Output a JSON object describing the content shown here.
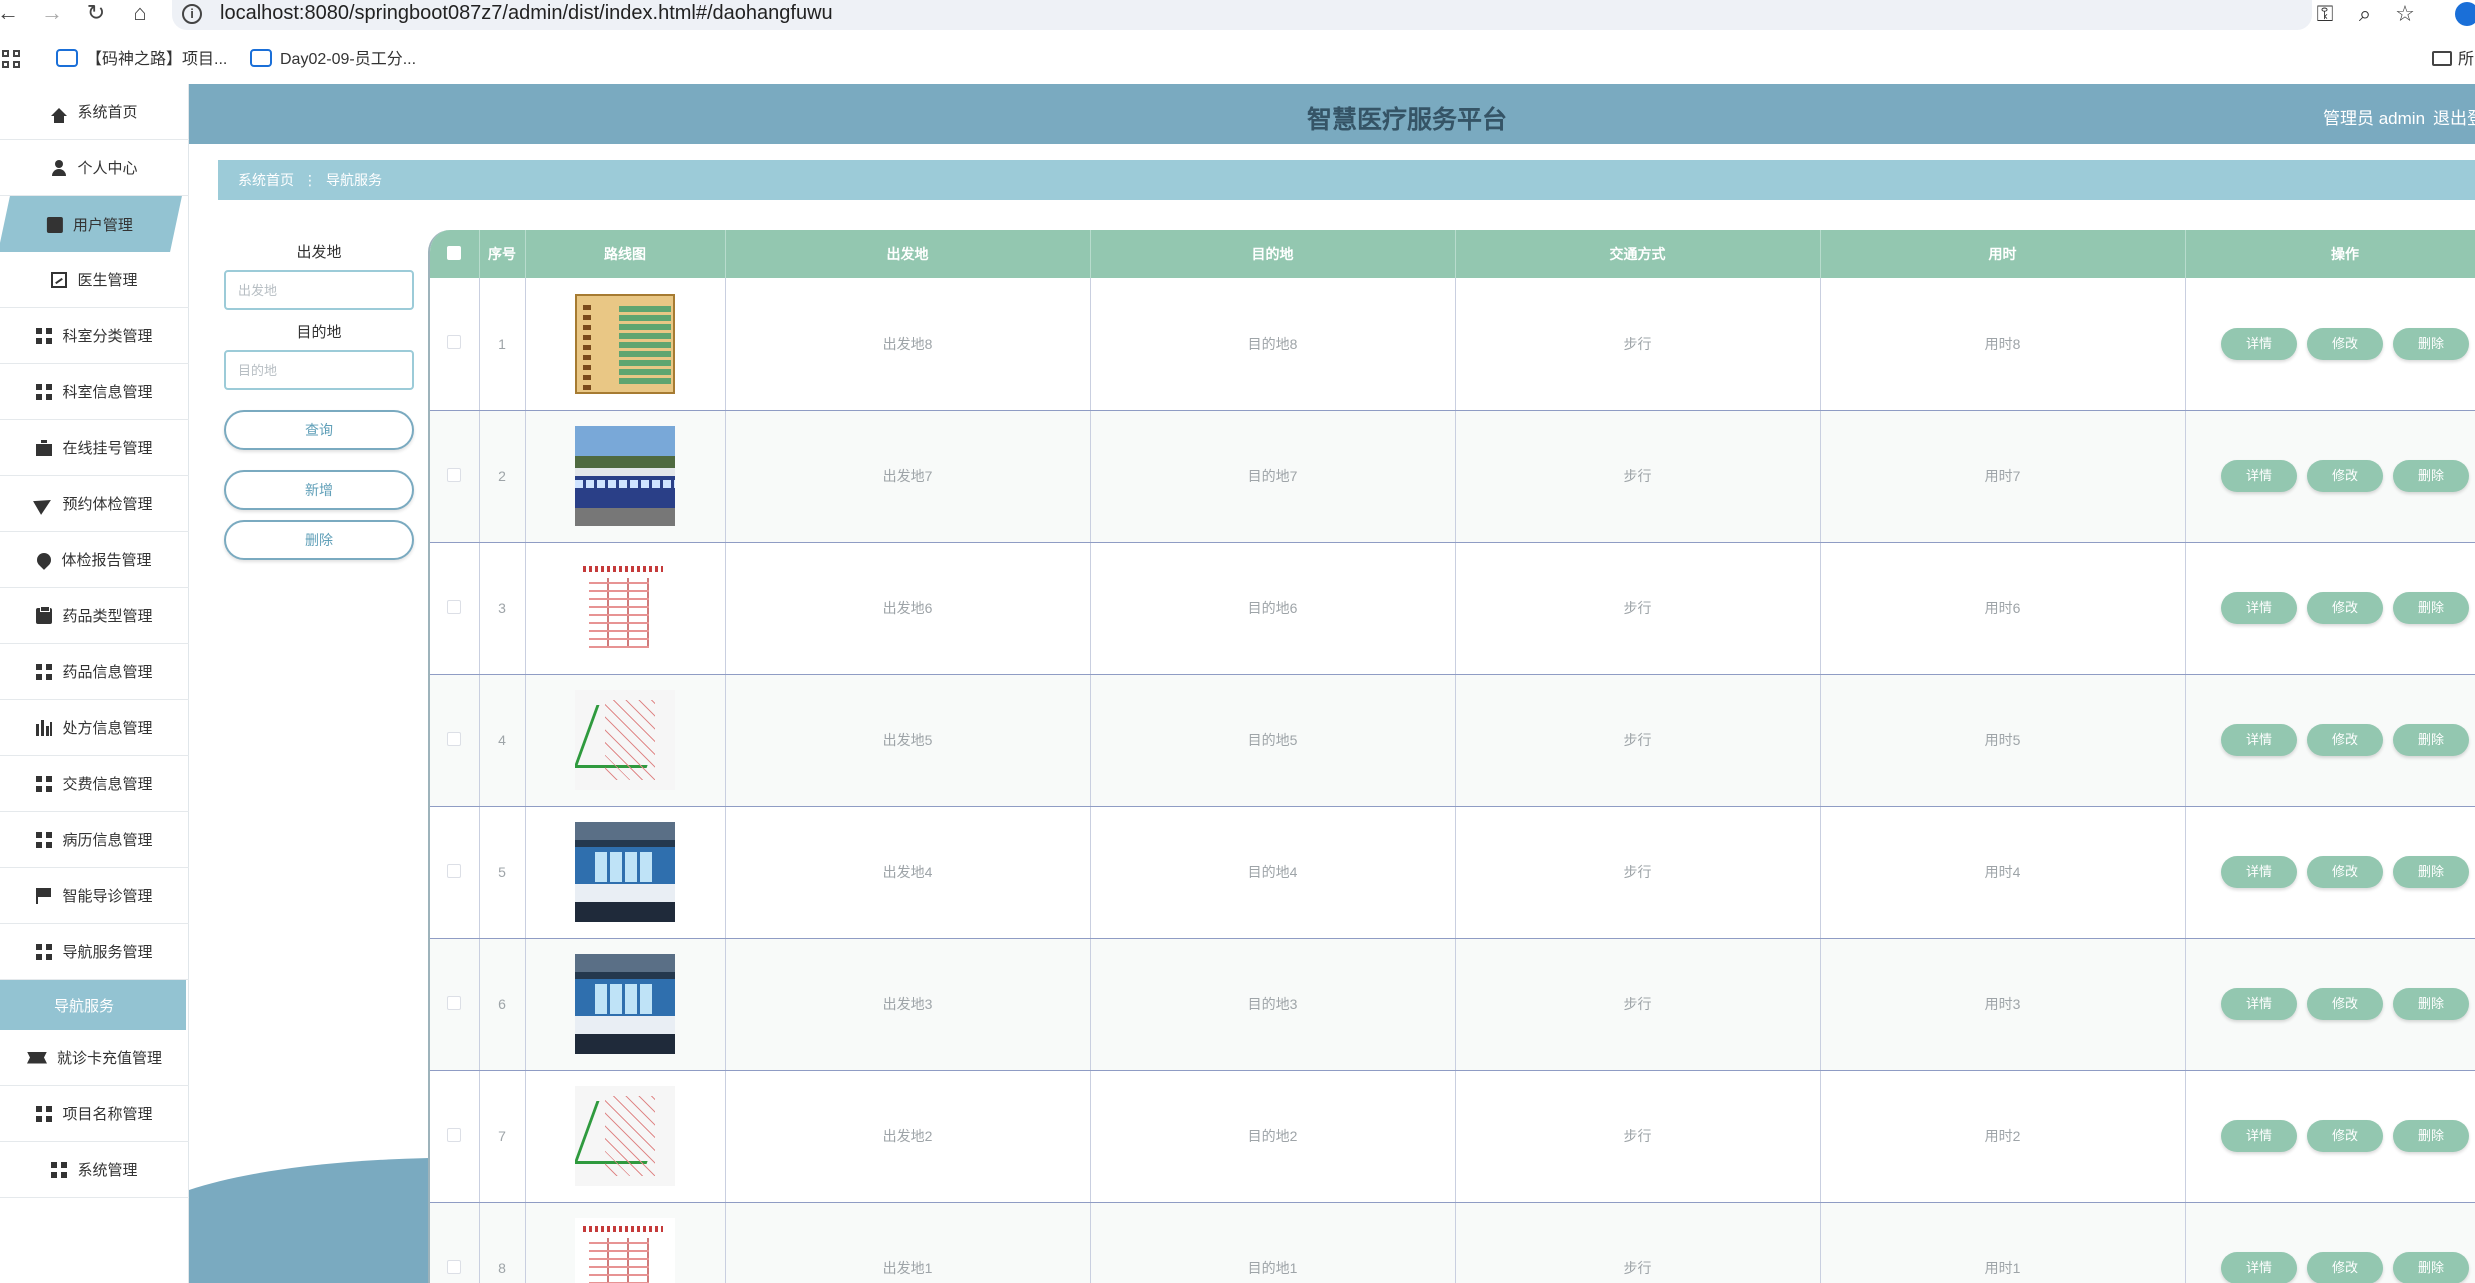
{
  "browser": {
    "url": "localhost:8080/springboot087z7/admin/dist/index.html#/daohangfuwu",
    "bookmarks": [
      "【码神之路】项目...",
      "Day02-09-员工分..."
    ],
    "folder_bookmark": "所"
  },
  "header": {
    "title": "智慧医疗服务平台",
    "admin": "管理员 admin",
    "logout": "退出登"
  },
  "sidebar": {
    "items": [
      {
        "label": "系统首页",
        "icon": "home-icon"
      },
      {
        "label": "个人中心",
        "icon": "user-icon"
      },
      {
        "label": "用户管理",
        "icon": "block-icon"
      },
      {
        "label": "医生管理",
        "icon": "chart-icon"
      },
      {
        "label": "科室分类管理",
        "icon": "grid-icon"
      },
      {
        "label": "科室信息管理",
        "icon": "grid-icon"
      },
      {
        "label": "在线挂号管理",
        "icon": "briefcase-icon"
      },
      {
        "label": "预约体检管理",
        "icon": "plane-icon"
      },
      {
        "label": "体检报告管理",
        "icon": "pin-icon"
      },
      {
        "label": "药品类型管理",
        "icon": "clipboard-icon"
      },
      {
        "label": "药品信息管理",
        "icon": "grid-icon"
      },
      {
        "label": "处方信息管理",
        "icon": "bars-icon"
      },
      {
        "label": "交费信息管理",
        "icon": "grid-icon"
      },
      {
        "label": "病历信息管理",
        "icon": "grid-icon"
      },
      {
        "label": "智能导诊管理",
        "icon": "flag-icon"
      },
      {
        "label": "导航服务管理",
        "icon": "grid-icon"
      },
      {
        "label": "导航服务",
        "icon": ""
      },
      {
        "label": "就诊卡充值管理",
        "icon": "ticket-icon"
      },
      {
        "label": "项目名称管理",
        "icon": "grid-icon"
      },
      {
        "label": "系统管理",
        "icon": "grid-icon"
      }
    ]
  },
  "breadcrumb": {
    "home": "系统首页",
    "separator": "⋮",
    "current": "导航服务"
  },
  "search": {
    "origin_label": "出发地",
    "origin_placeholder": "出发地",
    "destination_label": "目的地",
    "destination_placeholder": "目的地",
    "query_button": "查询",
    "add_button": "新增",
    "delete_button": "删除"
  },
  "table": {
    "headers": [
      "序号",
      "路线图",
      "出发地",
      "目的地",
      "交通方式",
      "用时",
      "操作"
    ],
    "actions": [
      "详情",
      "修改",
      "删除"
    ],
    "rows": [
      {
        "index": "1",
        "image": "old-map",
        "origin": "出发地8",
        "destination": "目的地8",
        "transport": "步行",
        "duration": "用时8"
      },
      {
        "index": "2",
        "image": "bus-green",
        "origin": "出发地7",
        "destination": "目的地7",
        "transport": "步行",
        "duration": "用时7"
      },
      {
        "index": "3",
        "image": "metro-red",
        "origin": "出发地6",
        "destination": "目的地6",
        "transport": "步行",
        "duration": "用时6"
      },
      {
        "index": "4",
        "image": "map-green",
        "origin": "出发地5",
        "destination": "目的地5",
        "transport": "步行",
        "duration": "用时5"
      },
      {
        "index": "5",
        "image": "bus-blue",
        "origin": "出发地4",
        "destination": "目的地4",
        "transport": "步行",
        "duration": "用时4"
      },
      {
        "index": "6",
        "image": "bus-blue",
        "origin": "出发地3",
        "destination": "目的地3",
        "transport": "步行",
        "duration": "用时3"
      },
      {
        "index": "7",
        "image": "map-green",
        "origin": "出发地2",
        "destination": "目的地2",
        "transport": "步行",
        "duration": "用时2"
      },
      {
        "index": "8",
        "image": "metro-red",
        "origin": "出发地1",
        "destination": "目的地1",
        "transport": "步行",
        "duration": "用时1"
      }
    ]
  },
  "colors": {
    "header_bg": "#7aaac0",
    "accent": "#93c3d2",
    "table_header": "#93c7b0"
  }
}
